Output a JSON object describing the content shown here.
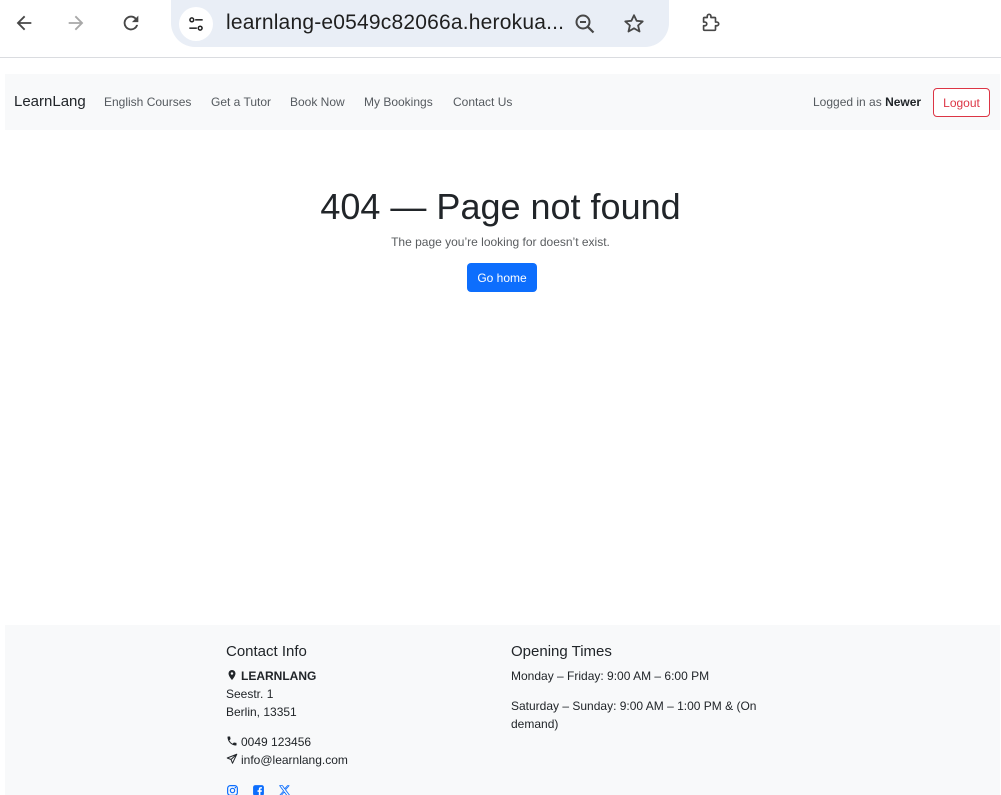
{
  "browser": {
    "url": "learnlang-e0549c82066a.herokua...",
    "icons": [
      "back-arrow-icon",
      "forward-arrow-icon",
      "reload-icon",
      "site-settings-icon",
      "zoom-out-icon",
      "star-icon",
      "extension-icon"
    ]
  },
  "navbar": {
    "brand": "LearnLang",
    "links": [
      "English Courses",
      "Get a Tutor",
      "Book Now",
      "My Bookings",
      "Contact Us"
    ],
    "logged_in_prefix": "Logged in as",
    "username": "Newer",
    "logout_label": "Logout"
  },
  "main": {
    "title": "404 — Page not found",
    "text": "The page you’re looking for doesn’t exist.",
    "button": "Go home"
  },
  "footer": {
    "contact": {
      "heading": "Contact Info",
      "name": "LEARNLANG",
      "street": "Seestr. 1",
      "city": "Berlin, 13351",
      "phone": "0049 123456",
      "email": "info@learnlang.com"
    },
    "hours": {
      "heading": "Opening Times",
      "weekday": "Monday – Friday: 9:00 AM – 6:00 PM",
      "weekend_line1": "Saturday – Sunday: 9:00 AM – 1:00 PM & (On",
      "weekend_line2": "demand)"
    },
    "social": [
      "instagram-icon",
      "facebook-icon",
      "x-icon"
    ]
  },
  "colors": {
    "primary": "#0d6efd",
    "danger": "#dc3545",
    "light_bg": "#f8f9fa",
    "omnibox_bg": "#e9eef6"
  }
}
